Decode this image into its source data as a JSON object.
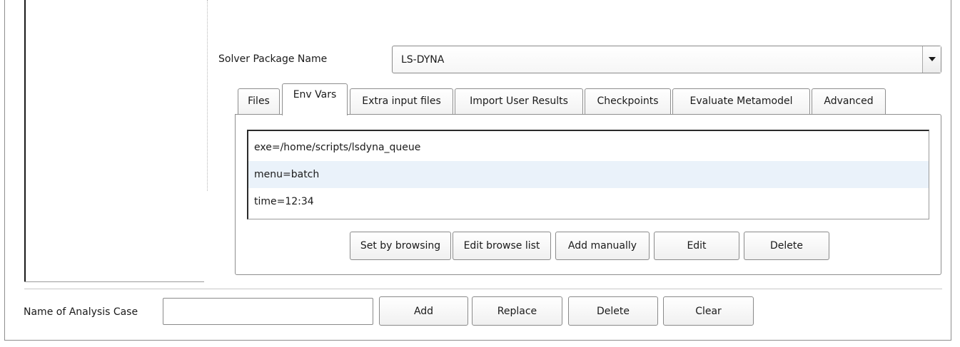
{
  "solver": {
    "label": "Solver Package Name",
    "selected": "LS-DYNA"
  },
  "tabs": [
    {
      "label": "Files"
    },
    {
      "label": "Env Vars"
    },
    {
      "label": "Extra input files"
    },
    {
      "label": "Import User Results"
    },
    {
      "label": "Checkpoints"
    },
    {
      "label": "Evaluate Metamodel"
    },
    {
      "label": "Advanced"
    }
  ],
  "active_tab": "Env Vars",
  "env_vars": [
    "exe=/home/scripts/lsdyna_queue",
    "menu=batch",
    "time=12:34"
  ],
  "env_buttons": {
    "set_by_browsing": "Set by browsing",
    "edit_browse_list": "Edit browse list",
    "add_manually": "Add manually",
    "edit": "Edit",
    "delete": "Delete"
  },
  "analysis": {
    "label": "Name of Analysis Case",
    "value": "",
    "add": "Add",
    "replace": "Replace",
    "delete": "Delete",
    "clear": "Clear"
  }
}
